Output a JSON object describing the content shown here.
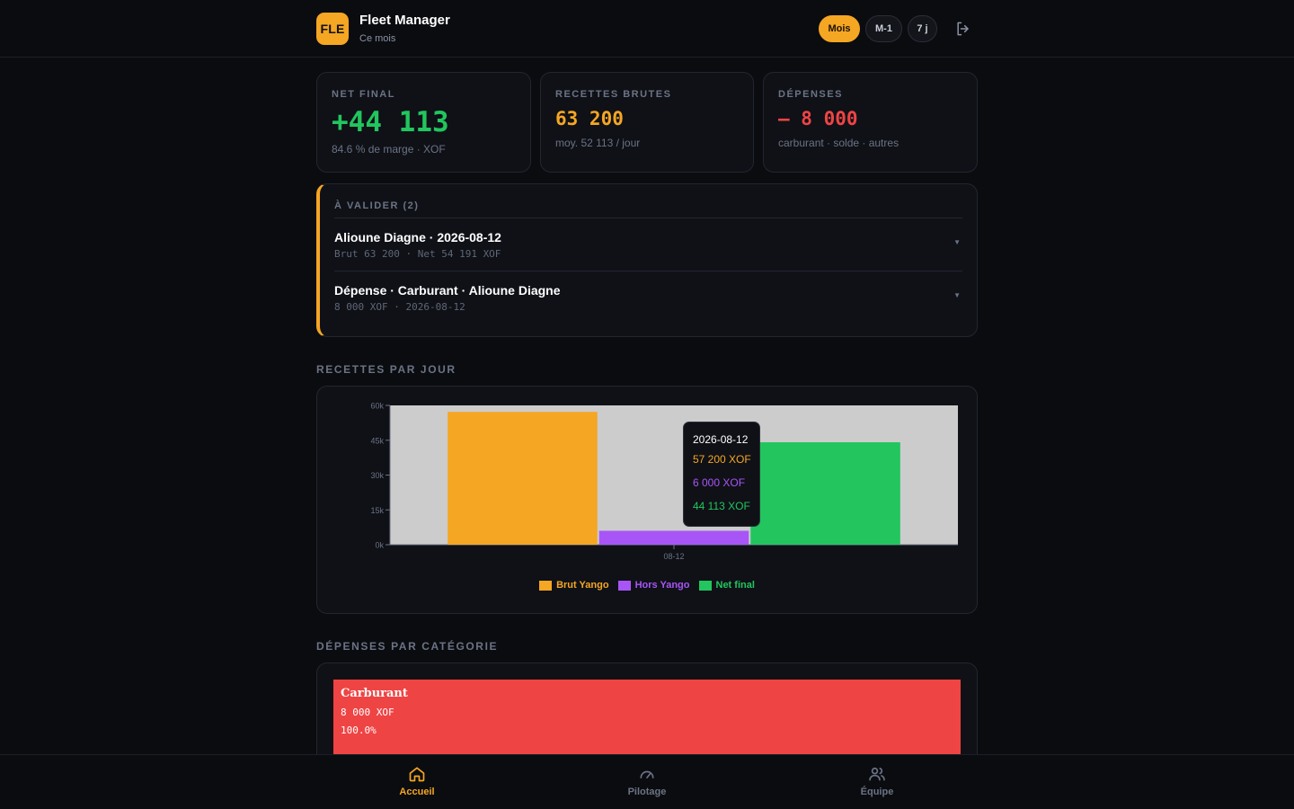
{
  "header": {
    "logo": "FLE",
    "title": "Fleet Manager",
    "subtitle": "Ce mois",
    "periods": [
      "Mois",
      "M-1",
      "7 j"
    ],
    "active_period": "Mois",
    "logout_icon": "logout-icon"
  },
  "stats": [
    {
      "label": "NET FINAL",
      "value": "+44 113",
      "sub": "84.6 % de marge · XOF",
      "color": "#22c55e"
    },
    {
      "label": "RECETTES BRUTES",
      "value": "63 200",
      "sub": "moy. 52 113 / jour",
      "color": "#f5a623"
    },
    {
      "label": "DÉPENSES",
      "value": "– 8 000",
      "sub": "carburant · solde · autres",
      "color": "#ef4444"
    }
  ],
  "validation": {
    "title": "À VALIDER (2)",
    "items": [
      {
        "main": "Alioune Diagne · 2026-08-12",
        "sub": "Brut 63 200 · Net 54 191 XOF",
        "caret": "▼"
      },
      {
        "main": "Dépense · Carburant · Alioune Diagne",
        "sub": "8 000 XOF · 2026-08-12",
        "caret": "▼"
      }
    ]
  },
  "sections": {
    "revenue_title": "RECETTES PAR JOUR",
    "expenses_title": "DÉPENSES PAR CATÉGORIE"
  },
  "chart_data": {
    "type": "bar",
    "categories": [
      "08-12"
    ],
    "series": [
      {
        "name": "Brut Yango",
        "values": [
          57200
        ],
        "color": "#f5a623"
      },
      {
        "name": "Hors Yango",
        "values": [
          6000
        ],
        "color": "#a855f7"
      },
      {
        "name": "Net final",
        "values": [
          44113
        ],
        "color": "#22c55e"
      }
    ],
    "ylim": [
      0,
      60000
    ],
    "yticks": [
      0,
      15000,
      30000,
      45000,
      60000
    ],
    "ytick_labels": [
      "0k",
      "15k",
      "30k",
      "45k",
      "60k"
    ],
    "grid": false,
    "legend": "bottom",
    "tooltip": {
      "date": "2026-08-12",
      "rows": [
        "57 200 XOF",
        "6 000 XOF",
        "44 113 XOF"
      ]
    }
  },
  "expenses": [
    {
      "name": "Carburant",
      "amount": "8 000 XOF",
      "percent": "100.0%",
      "color": "#ef4444"
    }
  ],
  "bottom_nav": [
    {
      "label": "Accueil",
      "icon": "home-icon",
      "active": true
    },
    {
      "label": "Pilotage",
      "icon": "gauge-icon",
      "active": false
    },
    {
      "label": "Équipe",
      "icon": "users-icon",
      "active": false
    }
  ]
}
